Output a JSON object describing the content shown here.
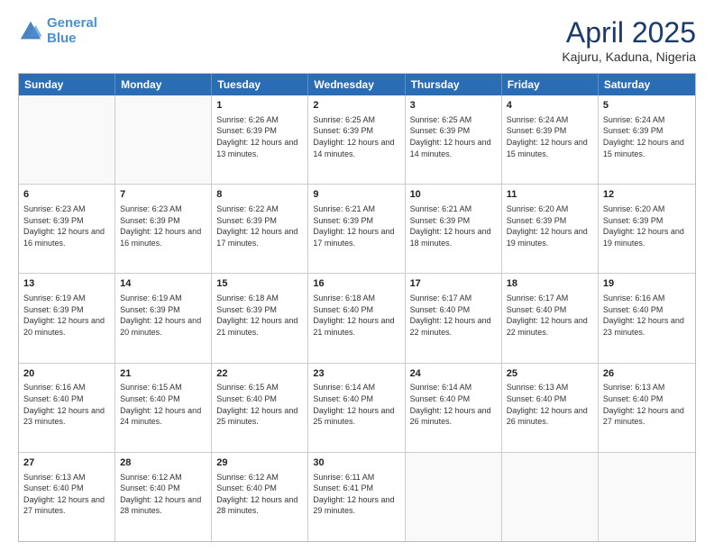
{
  "header": {
    "logo_line1": "General",
    "logo_line2": "Blue",
    "month": "April 2025",
    "location": "Kajuru, Kaduna, Nigeria"
  },
  "weekdays": [
    "Sunday",
    "Monday",
    "Tuesday",
    "Wednesday",
    "Thursday",
    "Friday",
    "Saturday"
  ],
  "weeks": [
    [
      {
        "day": "",
        "sunrise": "",
        "sunset": "",
        "daylight": ""
      },
      {
        "day": "",
        "sunrise": "",
        "sunset": "",
        "daylight": ""
      },
      {
        "day": "1",
        "sunrise": "Sunrise: 6:26 AM",
        "sunset": "Sunset: 6:39 PM",
        "daylight": "Daylight: 12 hours and 13 minutes."
      },
      {
        "day": "2",
        "sunrise": "Sunrise: 6:25 AM",
        "sunset": "Sunset: 6:39 PM",
        "daylight": "Daylight: 12 hours and 14 minutes."
      },
      {
        "day": "3",
        "sunrise": "Sunrise: 6:25 AM",
        "sunset": "Sunset: 6:39 PM",
        "daylight": "Daylight: 12 hours and 14 minutes."
      },
      {
        "day": "4",
        "sunrise": "Sunrise: 6:24 AM",
        "sunset": "Sunset: 6:39 PM",
        "daylight": "Daylight: 12 hours and 15 minutes."
      },
      {
        "day": "5",
        "sunrise": "Sunrise: 6:24 AM",
        "sunset": "Sunset: 6:39 PM",
        "daylight": "Daylight: 12 hours and 15 minutes."
      }
    ],
    [
      {
        "day": "6",
        "sunrise": "Sunrise: 6:23 AM",
        "sunset": "Sunset: 6:39 PM",
        "daylight": "Daylight: 12 hours and 16 minutes."
      },
      {
        "day": "7",
        "sunrise": "Sunrise: 6:23 AM",
        "sunset": "Sunset: 6:39 PM",
        "daylight": "Daylight: 12 hours and 16 minutes."
      },
      {
        "day": "8",
        "sunrise": "Sunrise: 6:22 AM",
        "sunset": "Sunset: 6:39 PM",
        "daylight": "Daylight: 12 hours and 17 minutes."
      },
      {
        "day": "9",
        "sunrise": "Sunrise: 6:21 AM",
        "sunset": "Sunset: 6:39 PM",
        "daylight": "Daylight: 12 hours and 17 minutes."
      },
      {
        "day": "10",
        "sunrise": "Sunrise: 6:21 AM",
        "sunset": "Sunset: 6:39 PM",
        "daylight": "Daylight: 12 hours and 18 minutes."
      },
      {
        "day": "11",
        "sunrise": "Sunrise: 6:20 AM",
        "sunset": "Sunset: 6:39 PM",
        "daylight": "Daylight: 12 hours and 19 minutes."
      },
      {
        "day": "12",
        "sunrise": "Sunrise: 6:20 AM",
        "sunset": "Sunset: 6:39 PM",
        "daylight": "Daylight: 12 hours and 19 minutes."
      }
    ],
    [
      {
        "day": "13",
        "sunrise": "Sunrise: 6:19 AM",
        "sunset": "Sunset: 6:39 PM",
        "daylight": "Daylight: 12 hours and 20 minutes."
      },
      {
        "day": "14",
        "sunrise": "Sunrise: 6:19 AM",
        "sunset": "Sunset: 6:39 PM",
        "daylight": "Daylight: 12 hours and 20 minutes."
      },
      {
        "day": "15",
        "sunrise": "Sunrise: 6:18 AM",
        "sunset": "Sunset: 6:39 PM",
        "daylight": "Daylight: 12 hours and 21 minutes."
      },
      {
        "day": "16",
        "sunrise": "Sunrise: 6:18 AM",
        "sunset": "Sunset: 6:40 PM",
        "daylight": "Daylight: 12 hours and 21 minutes."
      },
      {
        "day": "17",
        "sunrise": "Sunrise: 6:17 AM",
        "sunset": "Sunset: 6:40 PM",
        "daylight": "Daylight: 12 hours and 22 minutes."
      },
      {
        "day": "18",
        "sunrise": "Sunrise: 6:17 AM",
        "sunset": "Sunset: 6:40 PM",
        "daylight": "Daylight: 12 hours and 22 minutes."
      },
      {
        "day": "19",
        "sunrise": "Sunrise: 6:16 AM",
        "sunset": "Sunset: 6:40 PM",
        "daylight": "Daylight: 12 hours and 23 minutes."
      }
    ],
    [
      {
        "day": "20",
        "sunrise": "Sunrise: 6:16 AM",
        "sunset": "Sunset: 6:40 PM",
        "daylight": "Daylight: 12 hours and 23 minutes."
      },
      {
        "day": "21",
        "sunrise": "Sunrise: 6:15 AM",
        "sunset": "Sunset: 6:40 PM",
        "daylight": "Daylight: 12 hours and 24 minutes."
      },
      {
        "day": "22",
        "sunrise": "Sunrise: 6:15 AM",
        "sunset": "Sunset: 6:40 PM",
        "daylight": "Daylight: 12 hours and 25 minutes."
      },
      {
        "day": "23",
        "sunrise": "Sunrise: 6:14 AM",
        "sunset": "Sunset: 6:40 PM",
        "daylight": "Daylight: 12 hours and 25 minutes."
      },
      {
        "day": "24",
        "sunrise": "Sunrise: 6:14 AM",
        "sunset": "Sunset: 6:40 PM",
        "daylight": "Daylight: 12 hours and 26 minutes."
      },
      {
        "day": "25",
        "sunrise": "Sunrise: 6:13 AM",
        "sunset": "Sunset: 6:40 PM",
        "daylight": "Daylight: 12 hours and 26 minutes."
      },
      {
        "day": "26",
        "sunrise": "Sunrise: 6:13 AM",
        "sunset": "Sunset: 6:40 PM",
        "daylight": "Daylight: 12 hours and 27 minutes."
      }
    ],
    [
      {
        "day": "27",
        "sunrise": "Sunrise: 6:13 AM",
        "sunset": "Sunset: 6:40 PM",
        "daylight": "Daylight: 12 hours and 27 minutes."
      },
      {
        "day": "28",
        "sunrise": "Sunrise: 6:12 AM",
        "sunset": "Sunset: 6:40 PM",
        "daylight": "Daylight: 12 hours and 28 minutes."
      },
      {
        "day": "29",
        "sunrise": "Sunrise: 6:12 AM",
        "sunset": "Sunset: 6:40 PM",
        "daylight": "Daylight: 12 hours and 28 minutes."
      },
      {
        "day": "30",
        "sunrise": "Sunrise: 6:11 AM",
        "sunset": "Sunset: 6:41 PM",
        "daylight": "Daylight: 12 hours and 29 minutes."
      },
      {
        "day": "",
        "sunrise": "",
        "sunset": "",
        "daylight": ""
      },
      {
        "day": "",
        "sunrise": "",
        "sunset": "",
        "daylight": ""
      },
      {
        "day": "",
        "sunrise": "",
        "sunset": "",
        "daylight": ""
      }
    ]
  ]
}
